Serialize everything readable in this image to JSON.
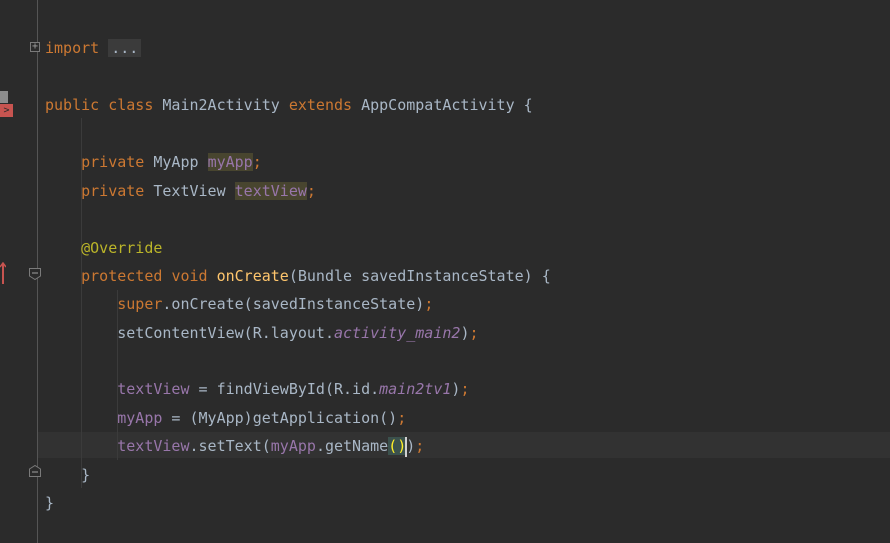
{
  "editor": {
    "language": "java",
    "line1": {
      "kw": "import",
      "folded": "..."
    },
    "line2": {
      "kw1": "public",
      "kw2": "class",
      "name": "Main2Activity",
      "kw3": "extends",
      "parent": "AppCompatActivity",
      "brace": "{"
    },
    "line3": {
      "kw": "private",
      "type": "MyApp",
      "field": "myApp",
      "semi": ";"
    },
    "line4": {
      "kw": "private",
      "type": "TextView",
      "field": "textView",
      "semi": ";"
    },
    "line5": {
      "annotation": "@Override"
    },
    "line6": {
      "kw1": "protected",
      "kw2": "void",
      "method": "onCreate",
      "params": "(Bundle savedInstanceState)",
      "brace": "{"
    },
    "line7": {
      "kw": "super",
      "rest": ".onCreate(savedInstanceState)",
      "semi": ";"
    },
    "line8": {
      "pre": "setContentView(R.layout.",
      "const": "activity_main2",
      "post": ")",
      "semi": ";"
    },
    "line9": {
      "field": "textView",
      "mid": " = findViewById(R.id.",
      "const": "main2tv1",
      "post": ")",
      "semi": ";"
    },
    "line10": {
      "field": "myApp",
      "mid": " = (MyApp)getApplication()",
      "semi": ";"
    },
    "line11": {
      "field1": "textView",
      "mid1": ".setText(",
      "field2": "myApp",
      "mid2": ".getName",
      "paren_open": "(",
      "paren_close": ")",
      "close": ")",
      "semi": ";"
    },
    "line12": {
      "brace": "}"
    },
    "line13": {
      "brace": "}"
    }
  },
  "gutter": {
    "fold_expand_icon": "plus-box-icon",
    "fold_collapse_icon": "minus-box-icon",
    "run_icon": "run-arrow-icon",
    "override_icon": "override-up-arrow-icon"
  },
  "colors": {
    "background": "#2b2b2b",
    "keyword": "#cc7832",
    "field": "#9876aa",
    "annotation": "#bbb529",
    "method_decl": "#ffc66d",
    "default_text": "#a9b7c6"
  }
}
